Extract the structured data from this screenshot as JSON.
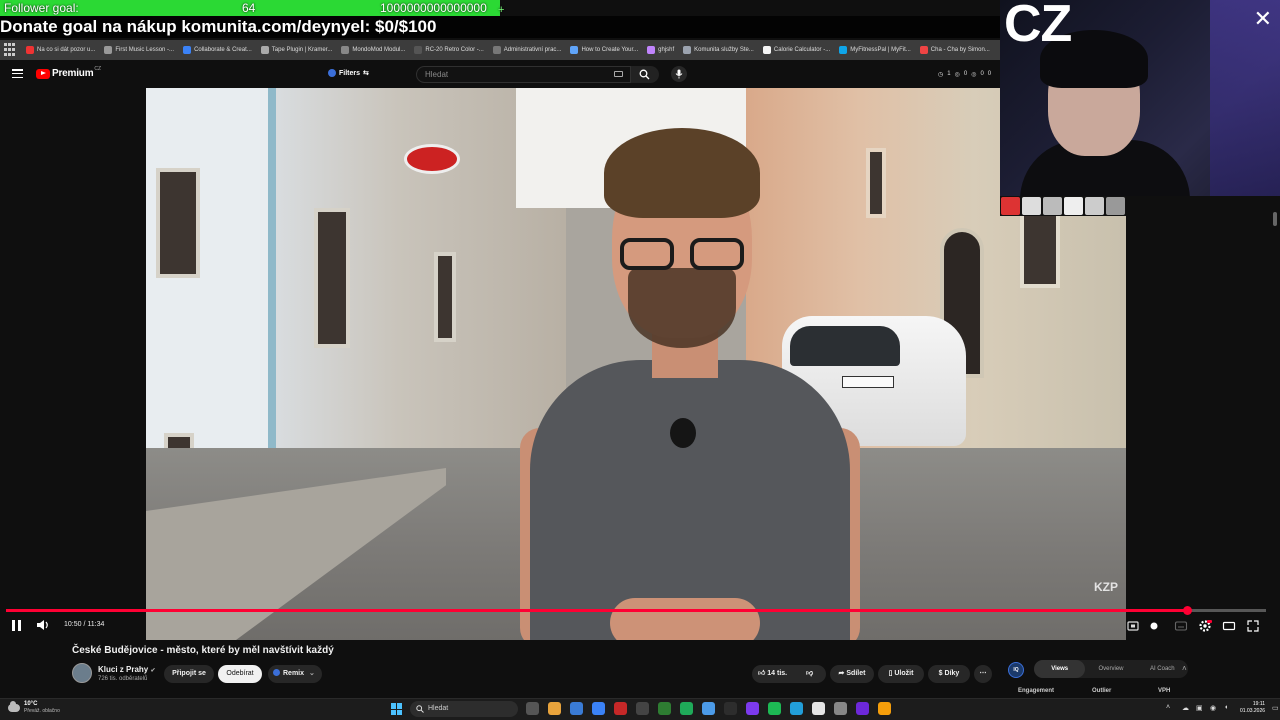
{
  "overlay": {
    "follower_goal_label": "Follower goal:",
    "follower_current": "64",
    "follower_target": "1000000000000000",
    "follower_plus": "+",
    "donate_text": "Donate goal na nákup komunita.com/deynyel: $0/$100"
  },
  "bookmarks": [
    {
      "label": "Na co si dát pozor u...",
      "color": "#e33"
    },
    {
      "label": "First Music Lesson -...",
      "color": "#999"
    },
    {
      "label": "Collaborate & Creat...",
      "color": "#3b82f6"
    },
    {
      "label": "Tape Plugin | Kramer...",
      "color": "#aaa"
    },
    {
      "label": "MondoMod Modul...",
      "color": "#888"
    },
    {
      "label": "RC-20 Retro Color -...",
      "color": "#555"
    },
    {
      "label": "Administrativní prac...",
      "color": "#777"
    },
    {
      "label": "How to Create Your...",
      "color": "#60a5fa"
    },
    {
      "label": "ghjshf",
      "color": "#c084fc"
    },
    {
      "label": "Komunita služby Ste...",
      "color": "#9ca3af"
    },
    {
      "label": "Calorie Calculator -...",
      "color": "#f5f5f5"
    },
    {
      "label": "MyFitnessPal | MyFit...",
      "color": "#0ea5e9"
    },
    {
      "label": "Cha - Cha by Simon...",
      "color": "#ef4444"
    }
  ],
  "header": {
    "logo_text": "Premium",
    "logo_region": "CZ",
    "filters_label": "Filters",
    "search_placeholder": "Hledat",
    "counts": [
      "1",
      "0",
      "0",
      "0"
    ]
  },
  "player": {
    "current_time": "10:50",
    "duration": "11:34",
    "time_text": "10:50 / 11:34",
    "progress_fraction": 0.937,
    "watermark": "KZP",
    "accent": "#ff0033"
  },
  "video_info": {
    "title": "České Budějovice - město, které by měl navštívit každý",
    "channel_name": "Kluci z Prahy",
    "subscribers": "726 tis. odběratelů",
    "join_label": "Připojit se",
    "subscribe_label": "Odebírat",
    "remix_label": "Remix",
    "likes": "14 tis.",
    "share_label": "Sdílet",
    "save_label": "Uložit",
    "thanks_label": "Díky"
  },
  "insights": {
    "badge": "IQ",
    "tabs": [
      "Views",
      "Overview",
      "AI Coach"
    ],
    "active_tab": "Views",
    "sub_labels": [
      "Engagement",
      "Outlier",
      "VPH"
    ]
  },
  "webcam": {
    "country_text": "CZ",
    "symbol": "✕"
  },
  "taskbar": {
    "weather_temp": "10°C",
    "weather_desc": "Převáž. oblačno",
    "search_label": "Hledat",
    "time": "19:11",
    "date": "01.03.2026"
  }
}
